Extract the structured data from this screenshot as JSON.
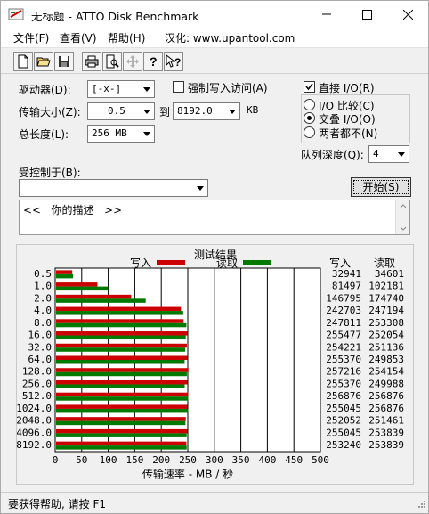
{
  "window": {
    "title": "无标题 - ATTO Disk Benchmark"
  },
  "menu": {
    "items": [
      "文件(F)",
      "查看(V)",
      "帮助(H)",
      "汉化: www.upantool.com"
    ]
  },
  "toolbar": {
    "icons": [
      "new-file-icon",
      "open-folder-icon",
      "save-icon",
      "print-icon",
      "print-preview-icon",
      "move-icon",
      "help-icon",
      "context-help-icon"
    ]
  },
  "form": {
    "drive_label": "驱动器(D):",
    "drive_value": "[-x-]",
    "force_write_label": "强制写入访问(A)",
    "transfer_label": "传输大小(Z):",
    "transfer_from": "0.5",
    "to_label": "到",
    "transfer_to": "8192.0",
    "kb_label": "KB",
    "total_label": "总长度(L):",
    "total_value": "256 MB",
    "direct_io_label": "直接 I/O(R)",
    "io_compare_label": "I/O 比较(C)",
    "overlap_io_label": "交叠 I/O(O)",
    "neither_label": "两者都不(N)",
    "queue_label": "队列深度(Q):",
    "queue_value": "4",
    "controlled_label": "受控制于(B):",
    "controlled_value": "",
    "start_button": "开始(S)",
    "description": "<<   你的描述   >>"
  },
  "results": {
    "title": "测试结果",
    "write_legend": "写入",
    "read_legend": "读取",
    "write_color": "#cc0000",
    "read_color": "#007a00",
    "write_header": "写入",
    "read_header": "读取"
  },
  "chart_data": {
    "type": "bar",
    "orientation": "horizontal",
    "categories": [
      "0.5",
      "1.0",
      "2.0",
      "4.0",
      "8.0",
      "16.0",
      "32.0",
      "64.0",
      "128.0",
      "256.0",
      "512.0",
      "1024.0",
      "2048.0",
      "4096.0",
      "8192.0"
    ],
    "series": [
      {
        "name": "写入",
        "values": [
          32941,
          81497,
          146795,
          242703,
          247811,
          255477,
          254221,
          255370,
          257216,
          255370,
          256876,
          255045,
          252052,
          255045,
          253240
        ]
      },
      {
        "name": "读取",
        "values": [
          34601,
          102181,
          174740,
          247194,
          253308,
          252054,
          251136,
          249853,
          254154,
          249988,
          256876,
          256876,
          251461,
          253839,
          253839
        ]
      }
    ],
    "xlabel": "传输速率 - MB / 秒",
    "xticks": [
      "0",
      "50",
      "100",
      "150",
      "200",
      "250",
      "300",
      "350",
      "400",
      "450",
      "500"
    ],
    "xlim": [
      0,
      500
    ],
    "value_unit_divisor": 1024
  },
  "status": {
    "text": "要获得帮助, 请按 F1"
  }
}
